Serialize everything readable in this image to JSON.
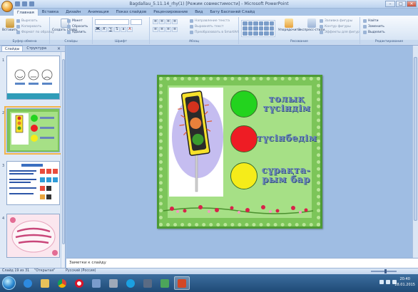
{
  "window": {
    "title": "Bagdallau_5.11.14_rhy(1) [Режим совместимости] - Microsoft PowerPoint",
    "buttons": [
      "–",
      "□",
      "✕"
    ]
  },
  "tabs": [
    {
      "label": "Главная",
      "active": true
    },
    {
      "label": "Вставка"
    },
    {
      "label": "Дизайн"
    },
    {
      "label": "Анимация"
    },
    {
      "label": "Показ слайдов"
    },
    {
      "label": "Рецензирование"
    },
    {
      "label": "Вид"
    },
    {
      "label": "Бату Баспанвй Слайд"
    }
  ],
  "ribbon": {
    "clipboard": {
      "paste": "Вставить",
      "cut": "Вырезать",
      "copy": "Копировать",
      "format": "Формат по образцу",
      "label": "Буфер обмена"
    },
    "slides": {
      "new": "Создать слайд",
      "layout": "Макет",
      "reset": "Сбросить",
      "delete": "Удалить",
      "label": "Слайды"
    },
    "font": {
      "label": "Шрифт"
    },
    "paragraph": {
      "direction": "Направление текста",
      "align": "Выровнять текст",
      "smartart": "Преобразовать в SmartArt",
      "label": "Абзац"
    },
    "drawing": {
      "arrange": "Упорядочить",
      "styles": "Экспресс-стили",
      "fill": "Заливка фигуры",
      "outline": "Контур фигуры",
      "effects": "Эффекты для фигур",
      "label": "Рисование"
    },
    "editing": {
      "find": "Найти",
      "replace": "Заменить",
      "select": "Выделить",
      "label": "Редактирование"
    }
  },
  "left_panel": {
    "tab_slides": "Слайды",
    "tab_outline": "Структура",
    "close": "×",
    "slides": [
      {
        "number": "1"
      },
      {
        "number": "2",
        "selected": true
      },
      {
        "number": "3"
      },
      {
        "number": "4"
      }
    ]
  },
  "slide": {
    "labels": {
      "green": "толық түсіндім",
      "red": "түсінбедім",
      "yellow": "сұрақта-рым бар"
    },
    "colors": {
      "green": "#23d31e",
      "red": "#ee1c24",
      "yellow": "#f5ec1a",
      "frame": "#4d9a35"
    }
  },
  "notes": {
    "placeholder": "Заметки к слайду"
  },
  "status": {
    "slide_info": "Слайд 19 из 31",
    "theme": "\"Открытая\"",
    "language": "Русский (Россия)"
  },
  "taskbar": {
    "time": "20:40",
    "date": "28.01.2015"
  }
}
